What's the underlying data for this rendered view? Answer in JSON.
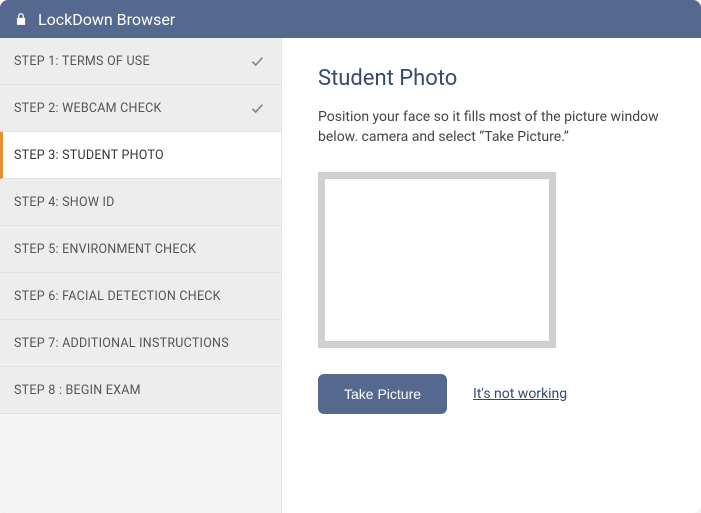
{
  "titlebar": {
    "title": "LockDown Browser"
  },
  "sidebar": {
    "steps": [
      {
        "label": "STEP 1: TERMS OF USE",
        "done": true
      },
      {
        "label": "STEP 2: WEBCAM CHECK",
        "done": true
      },
      {
        "label": "STEP 3: STUDENT PHOTO",
        "active": true
      },
      {
        "label": "STEP 4: SHOW ID"
      },
      {
        "label": "STEP 5: ENVIRONMENT CHECK"
      },
      {
        "label": "STEP 6: FACIAL DETECTION CHECK"
      },
      {
        "label": "STEP 7: ADDITIONAL INSTRUCTIONS"
      },
      {
        "label": "STEP 8 : BEGIN EXAM"
      }
    ]
  },
  "main": {
    "heading": "Student Photo",
    "instructions": "Position your face so it fills most of the picture window below. camera and select “Take Picture.”",
    "take_picture_label": "Take Picture",
    "not_working_label": "It's not working"
  },
  "colors": {
    "header_bg": "#54698d",
    "accent_orange": "#e88c30"
  }
}
